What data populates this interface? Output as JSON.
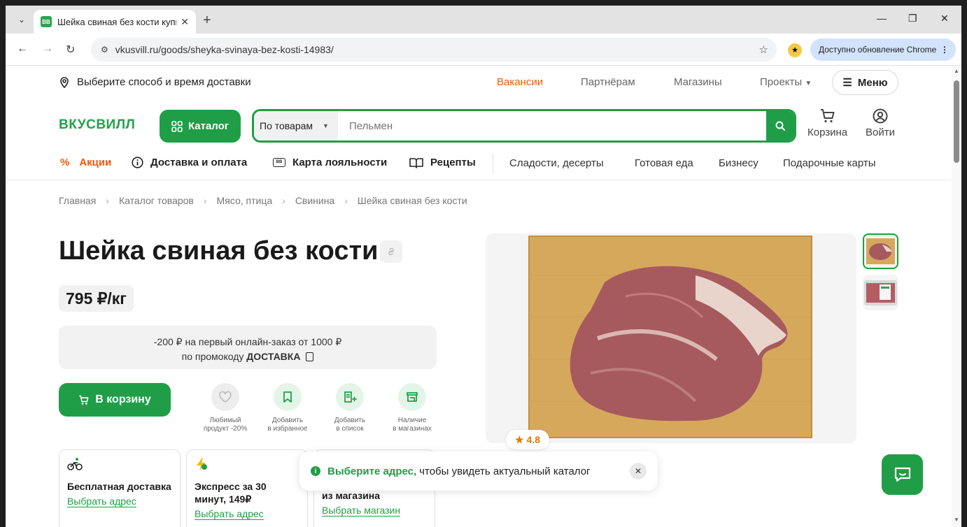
{
  "browser": {
    "tab_title": "Шейка свиная без кости купить",
    "favicon_text": "ВВ",
    "url": "vkusvill.ru/goods/sheyka-svinaya-bez-kosti-14983/",
    "update_label": "Доступно обновление Chrome"
  },
  "header": {
    "delivery_prompt": "Выберите способ и время доставки",
    "links": [
      "Вакансии",
      "Партнёрам",
      "Магазины",
      "Проекты"
    ],
    "menu_label": "Меню",
    "logo": "ВКУСВИЛЛ",
    "catalog_label": "Каталог",
    "search_scope": "По товарам",
    "search_placeholder": "Пельмен",
    "cart_label": "Корзина",
    "login_label": "Войти"
  },
  "catnav": {
    "promo": "Акции",
    "delivery": "Доставка и оплата",
    "loyalty": "Карта лояльности",
    "recipes": "Рецепты",
    "sweets": "Сладости, десерты",
    "ready_food": "Готовая еда",
    "business": "Бизнесу",
    "gift_cards": "Подарочные карты"
  },
  "breadcrumbs": [
    "Главная",
    "Каталог товаров",
    "Мясо, птица",
    "Свинина",
    "Шейка свиная без кости"
  ],
  "product": {
    "title": "Шейка свиная без кости",
    "price": "795 ₽/кг",
    "promo_line1": "-200 ₽ на первый онлайн-заказ от 1000 ₽",
    "promo_line2_prefix": "по промокоду ",
    "promo_code": "ДОСТАВКА",
    "cart_button": "В корзину",
    "rating": "4.8",
    "actions": [
      {
        "line1": "Любимый",
        "line2": "продукт -20%"
      },
      {
        "line1": "Добавить",
        "line2": "в избранное"
      },
      {
        "line1": "Добавить",
        "line2": "в список"
      },
      {
        "line1": "Наличие",
        "line2": "в магазинах"
      }
    ]
  },
  "delivery_cards": [
    {
      "title": "Бесплатная доставка",
      "link": "Выбрать адрес"
    },
    {
      "title": "Экспресс за 30 минут, 149₽",
      "link": "Выбрать адрес"
    },
    {
      "title": "из магазина",
      "link": "Выбрать магазин"
    }
  ],
  "toast": {
    "highlight": "Выберите адрес,",
    "text": "чтобы увидеть актуальный каталог"
  },
  "colors": {
    "brand_green": "#1f9e47",
    "accent_orange": "#f25a0b"
  }
}
